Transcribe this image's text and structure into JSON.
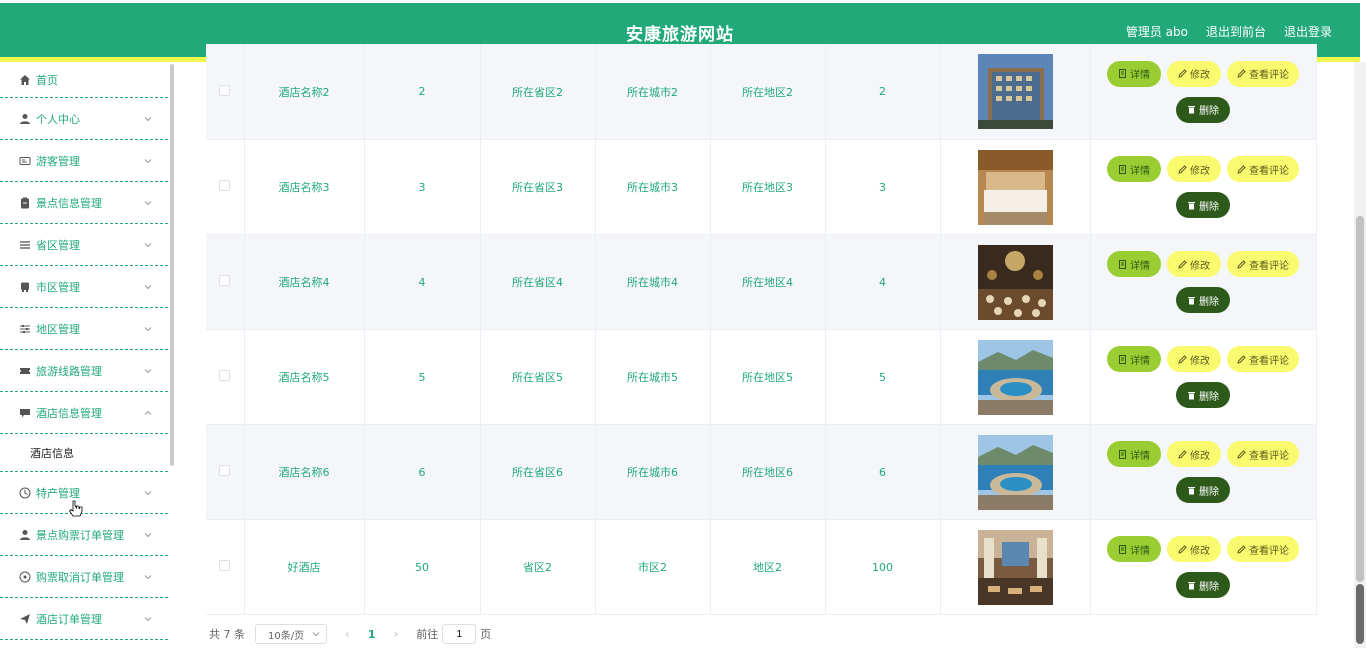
{
  "header": {
    "title": "安康旅游网站",
    "admin_label": "管理员 abo",
    "to_front": "退出到前台",
    "logout": "退出登录",
    "bg_color": "#21a97a",
    "accent": "#eef84a"
  },
  "sidebar": {
    "items": [
      {
        "label": "首页",
        "icon": "home-icon"
      },
      {
        "label": "个人中心",
        "icon": "user-icon"
      },
      {
        "label": "游客管理",
        "icon": "id-card-icon"
      },
      {
        "label": "景点信息管理",
        "icon": "clipboard-icon"
      },
      {
        "label": "省区管理",
        "icon": "list-icon"
      },
      {
        "label": "市区管理",
        "icon": "bus-icon"
      },
      {
        "label": "地区管理",
        "icon": "sliders-icon"
      },
      {
        "label": "旅游线路管理",
        "icon": "ticket-icon"
      },
      {
        "label": "酒店信息管理",
        "icon": "chat-icon",
        "expanded": true
      },
      {
        "label": "特产管理",
        "icon": "clock-icon"
      },
      {
        "label": "景点购票订单管理",
        "icon": "user-icon"
      },
      {
        "label": "购票取消订单管理",
        "icon": "compass-icon"
      },
      {
        "label": "酒店订单管理",
        "icon": "send-icon"
      }
    ],
    "submenu": {
      "label": "酒店信息"
    }
  },
  "table": {
    "rows": [
      {
        "name": "酒店名称2",
        "star": "2",
        "province": "所在省区2",
        "city": "所在城市2",
        "area": "所在地区2",
        "price": "2",
        "image": "hotel-exterior"
      },
      {
        "name": "酒店名称3",
        "star": "3",
        "province": "所在省区3",
        "city": "所在城市3",
        "area": "所在地区3",
        "price": "3",
        "image": "hotel-room"
      },
      {
        "name": "酒店名称4",
        "star": "4",
        "province": "所在省区4",
        "city": "所在城市4",
        "area": "所在地区4",
        "price": "4",
        "image": "ballroom"
      },
      {
        "name": "酒店名称5",
        "star": "5",
        "province": "所在省区5",
        "city": "所在城市5",
        "area": "所在地区5",
        "price": "5",
        "image": "seaside-resort"
      },
      {
        "name": "酒店名称6",
        "star": "6",
        "province": "所在省区6",
        "city": "所在城市6",
        "area": "所在地区6",
        "price": "6",
        "image": "seaside-resort"
      },
      {
        "name": "好酒店",
        "star": "50",
        "province": "省区2",
        "city": "市区2",
        "area": "地区2",
        "price": "100",
        "image": "hotel-lobby"
      }
    ],
    "buttons": {
      "detail": "详情",
      "edit": "修改",
      "review": "查看评论",
      "delete": "删除"
    }
  },
  "pagination": {
    "total": "共 7 条",
    "page_size": "10条/页",
    "current_page": "1",
    "goto_prefix": "前往",
    "goto_value": "1",
    "goto_suffix": "页"
  }
}
